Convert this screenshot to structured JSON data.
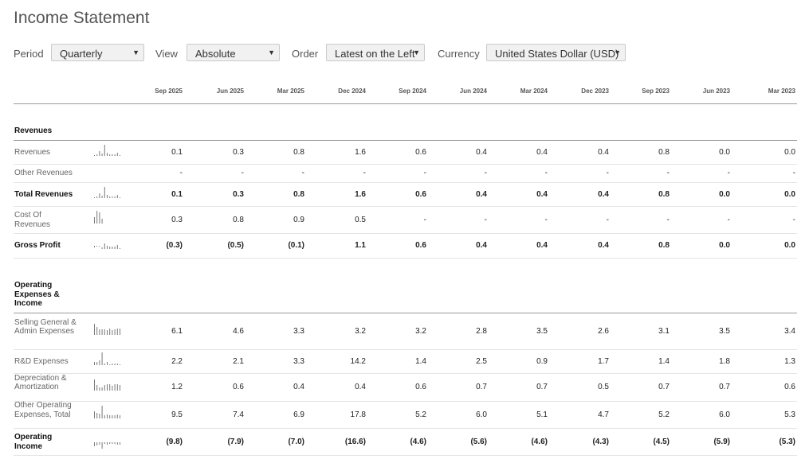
{
  "title": "Income Statement",
  "controls": [
    {
      "label": "Period",
      "value": "Quarterly"
    },
    {
      "label": "View",
      "value": "Absolute"
    },
    {
      "label": "Order",
      "value": "Latest on the Left"
    },
    {
      "label": "Currency",
      "value": "United States Dollar (USD)"
    }
  ],
  "periods": [
    "Sep 2025",
    "Jun 2025",
    "Mar 2025",
    "Dec 2024",
    "Sep 2024",
    "Jun 2024",
    "Mar 2024",
    "Dec 2023",
    "Sep 2023",
    "Jun 2023",
    "Mar 2023"
  ],
  "sections": [
    {
      "title": "Revenues",
      "rows": [
        {
          "label": "Revenues",
          "bold": false,
          "values": [
            "0.1",
            "0.3",
            "0.8",
            "1.6",
            "0.6",
            "0.4",
            "0.4",
            "0.4",
            "0.8",
            "0.0",
            "0.0"
          ]
        },
        {
          "label": "Other Revenues",
          "bold": false,
          "values": [
            "-",
            "-",
            "-",
            "-",
            "-",
            "-",
            "-",
            "-",
            "-",
            "-",
            "-"
          ]
        },
        {
          "label": "Total Revenues",
          "bold": true,
          "values": [
            "0.1",
            "0.3",
            "0.8",
            "1.6",
            "0.6",
            "0.4",
            "0.4",
            "0.4",
            "0.8",
            "0.0",
            "0.0"
          ]
        },
        {
          "label": "Cost Of Revenues",
          "bold": false,
          "values": [
            "0.3",
            "0.8",
            "0.9",
            "0.5",
            "-",
            "-",
            "-",
            "-",
            "-",
            "-",
            "-"
          ]
        },
        {
          "label": "Gross Profit",
          "bold": true,
          "values": [
            "(0.3)",
            "(0.5)",
            "(0.1)",
            "1.1",
            "0.6",
            "0.4",
            "0.4",
            "0.4",
            "0.8",
            "0.0",
            "0.0"
          ]
        }
      ]
    },
    {
      "title": "Operating Expenses & Income",
      "rows": [
        {
          "label": "Selling General & Admin Expenses",
          "bold": false,
          "values": [
            "6.1",
            "4.6",
            "3.3",
            "3.2",
            "3.2",
            "2.8",
            "3.5",
            "2.6",
            "3.1",
            "3.5",
            "3.4"
          ]
        },
        {
          "label": "R&D Expenses",
          "bold": false,
          "values": [
            "2.2",
            "2.1",
            "3.3",
            "14.2",
            "1.4",
            "2.5",
            "0.9",
            "1.7",
            "1.4",
            "1.8",
            "1.3"
          ]
        },
        {
          "label": "Depreciation & Amortization",
          "bold": false,
          "values": [
            "1.2",
            "0.6",
            "0.4",
            "0.4",
            "0.6",
            "0.7",
            "0.7",
            "0.5",
            "0.7",
            "0.7",
            "0.6"
          ]
        },
        {
          "label": "Other Operating Expenses, Total",
          "bold": false,
          "values": [
            "9.5",
            "7.4",
            "6.9",
            "17.8",
            "5.2",
            "6.0",
            "5.1",
            "4.7",
            "5.2",
            "6.0",
            "5.3"
          ]
        },
        {
          "label": "Operating Income",
          "bold": true,
          "values": [
            "(9.8)",
            "(7.9)",
            "(7.0)",
            "(16.6)",
            "(4.6)",
            "(5.6)",
            "(4.6)",
            "(4.3)",
            "(4.5)",
            "(5.9)",
            "(5.3)"
          ]
        }
      ]
    }
  ]
}
